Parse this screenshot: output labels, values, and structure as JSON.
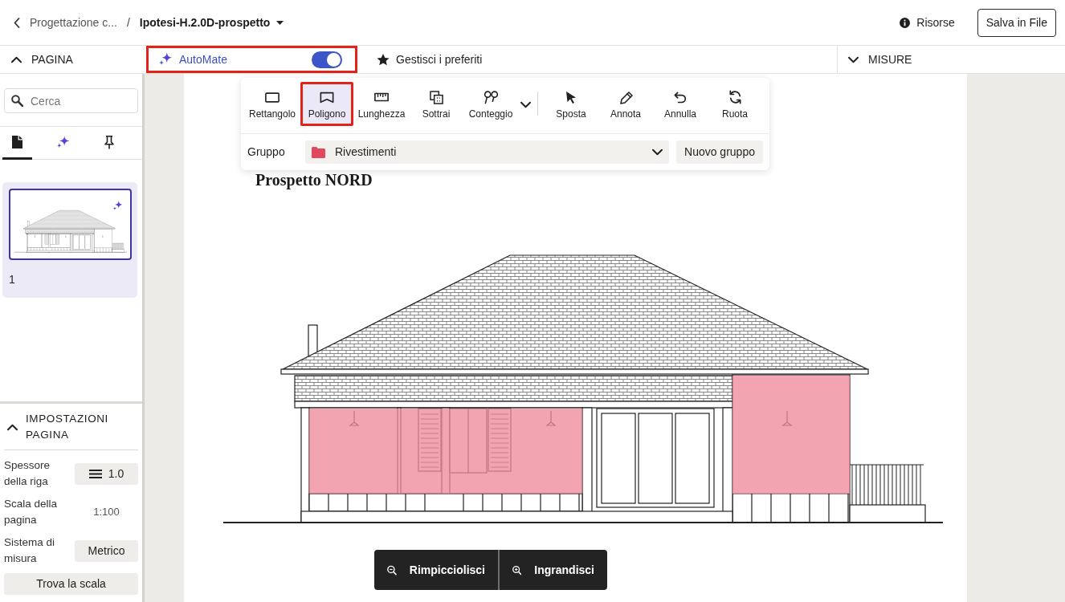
{
  "breadcrumb": {
    "parent": "Progettazione c...",
    "separator": "/",
    "current": "Ipotesi-H.2.0D-prospetto"
  },
  "header_actions": {
    "resources": "Risorse",
    "save": "Salva in File"
  },
  "left_panel": {
    "title": "PAGINA",
    "expanded": true,
    "search": {
      "placeholder": "Cerca"
    },
    "tabs": [
      {
        "kind": "pages",
        "selected": true
      },
      {
        "kind": "automate",
        "selected": false
      },
      {
        "kind": "pinned",
        "selected": false
      }
    ],
    "pages": [
      {
        "number": "1",
        "selected": true,
        "automated": true
      }
    ]
  },
  "page_settings": {
    "title": "IMPOSTAZIONI PAGINA",
    "expanded": true,
    "rows": [
      {
        "kind": "line_weight",
        "label": "Spessore della riga",
        "value": "1.0"
      },
      {
        "kind": "text",
        "label": "Scala della pagina",
        "value": "1:100"
      },
      {
        "kind": "select",
        "label": "Sistema di misura",
        "value": "Metrico"
      }
    ],
    "action": "Trova la scala"
  },
  "automate": {
    "label": "AutoMate",
    "on": true,
    "highlighted": true
  },
  "favorites": {
    "label": "Gestisci i preferiti"
  },
  "right_panel": {
    "title": "MISURE",
    "expanded": false
  },
  "toolbar": {
    "tools": [
      {
        "kind": "rectangle",
        "label": "Rettangolo",
        "selected": false,
        "highlighted": false
      },
      {
        "kind": "polygon",
        "label": "Poligono",
        "selected": true,
        "highlighted": true
      },
      {
        "kind": "length",
        "label": "Lunghezza",
        "selected": false,
        "highlighted": false
      },
      {
        "kind": "subtract",
        "label": "Sottrai",
        "selected": false,
        "highlighted": false
      },
      {
        "kind": "count",
        "label": "Conteggio",
        "selected": false,
        "highlighted": false
      }
    ],
    "more_tools": true,
    "actions": [
      {
        "kind": "move",
        "label": "Sposta"
      },
      {
        "kind": "annotate",
        "label": "Annota"
      },
      {
        "kind": "undo",
        "label": "Annulla"
      },
      {
        "kind": "rotate",
        "label": "Ruota"
      }
    ],
    "group": {
      "label": "Gruppo",
      "value": "Rivestimenti",
      "new_button": "Nuovo gruppo"
    }
  },
  "drawing": {
    "title": "Prospetto NORD"
  },
  "zoom": {
    "out": "Rimpicciolisci",
    "in": "Ingrandisci"
  }
}
